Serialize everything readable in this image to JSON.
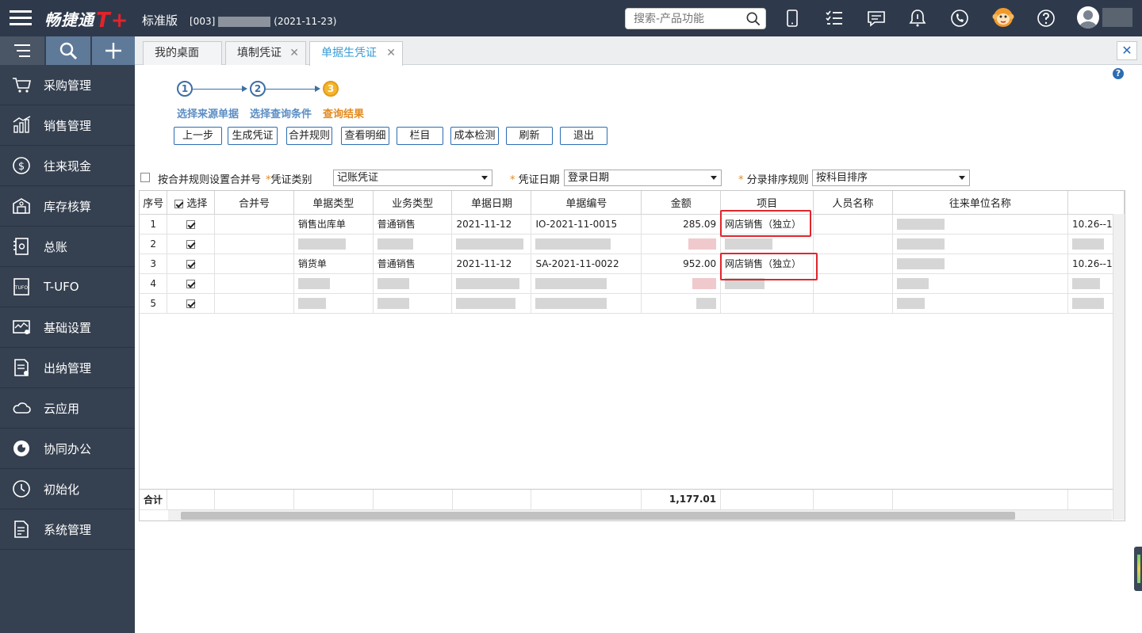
{
  "brand": {
    "name": "畅捷通",
    "logo_suffix": "T+",
    "edition": "标准版",
    "account_prefix": "[003]",
    "account_date": "(2021-11-23)"
  },
  "search": {
    "placeholder": "搜索-产品功能"
  },
  "topbar_icons": [
    "mobile-icon",
    "tasks-icon",
    "message-icon",
    "notification-icon",
    "phone-service-icon",
    "monkey-mascot-icon",
    "help-icon",
    "user-avatar-icon"
  ],
  "sidebar": {
    "items": [
      {
        "label": "采购管理",
        "icon": "cart-icon"
      },
      {
        "label": "销售管理",
        "icon": "sales-chart-icon"
      },
      {
        "label": "往来现金",
        "icon": "dollar-icon"
      },
      {
        "label": "库存核算",
        "icon": "warehouse-icon"
      },
      {
        "label": "总账",
        "icon": "ledger-icon"
      },
      {
        "label": "T-UFO",
        "icon": "tufo-icon"
      },
      {
        "label": "基础设置",
        "icon": "settings-chart-icon"
      },
      {
        "label": "出纳管理",
        "icon": "cashier-icon"
      },
      {
        "label": "云应用",
        "icon": "cloud-icon"
      },
      {
        "label": "协同办公",
        "icon": "collab-icon"
      },
      {
        "label": "初始化",
        "icon": "init-clock-icon"
      },
      {
        "label": "系统管理",
        "icon": "system-doc-icon"
      }
    ]
  },
  "tabs": [
    {
      "label": "我的桌面"
    },
    {
      "label": "填制凭证"
    },
    {
      "label": "单据生凭证"
    }
  ],
  "steps": [
    {
      "num": "1",
      "label": "选择来源单据"
    },
    {
      "num": "2",
      "label": "选择查询条件"
    },
    {
      "num": "3",
      "label": "查询结果"
    }
  ],
  "toolbar": [
    "上一步",
    "生成凭证",
    "合并规则",
    "查看明细",
    "栏目",
    "成本检测",
    "刷新",
    "退出"
  ],
  "options": {
    "merge_checkbox_label": "按合并规则设置合并号",
    "voucher_type_label": "凭证类别",
    "voucher_type_value": "记账凭证",
    "voucher_date_label": "凭证日期",
    "voucher_date_value": "登录日期",
    "sort_rule_label": "分录排序规则",
    "sort_rule_value": "按科目排序"
  },
  "grid": {
    "headers": [
      "序号",
      "选择",
      "合并号",
      "单据类型",
      "业务类型",
      "单据日期",
      "单据编号",
      "金额",
      "项目",
      "人员名称",
      "往来单位名称",
      ""
    ],
    "rows": [
      {
        "seq": "1",
        "checked": true,
        "merge": "",
        "doc_type": "销售出库单",
        "biz_type": "普通销售",
        "date": "2021-11-12",
        "number": "IO-2021-11-0015",
        "amount": "285.09",
        "project": "网店销售（独立）",
        "person": "",
        "partner": "",
        "extra": "10.26--1"
      },
      {
        "seq": "2",
        "checked": true,
        "redacted": true
      },
      {
        "seq": "3",
        "checked": true,
        "merge": "",
        "doc_type": "销货单",
        "biz_type": "普通销售",
        "date": "2021-11-12",
        "number": "SA-2021-11-0022",
        "amount": "952.00",
        "project": "网店销售（独立）",
        "person": "",
        "partner": "",
        "extra": "10.26--1"
      },
      {
        "seq": "4",
        "checked": true,
        "redacted": true
      },
      {
        "seq": "5",
        "checked": true,
        "redacted": true
      }
    ],
    "total_label": "合计",
    "total_amount": "1,177.01"
  },
  "colors": {
    "topbar": "#2e3a4b",
    "sidebar": "#354050",
    "accent": "#3a9bd5",
    "highlight": "#e0262c",
    "step_current": "#f5b52c"
  }
}
